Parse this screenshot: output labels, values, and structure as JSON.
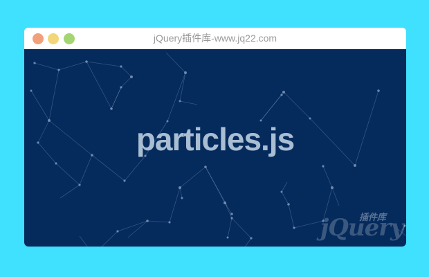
{
  "window": {
    "title": "jQuery插件库-www.jq22.com",
    "controls": [
      "close",
      "minimize",
      "maximize"
    ]
  },
  "content": {
    "heading": "particles.js",
    "background_color": "#052a5c",
    "particle_color": "#8aa6c8"
  },
  "watermark": {
    "brand": "jQuery",
    "label_cn": "插件库"
  },
  "colors": {
    "page_background": "#40e0ff",
    "close": "#f2a07c",
    "minimize": "#f3d67a",
    "maximize": "#a3d672"
  }
}
